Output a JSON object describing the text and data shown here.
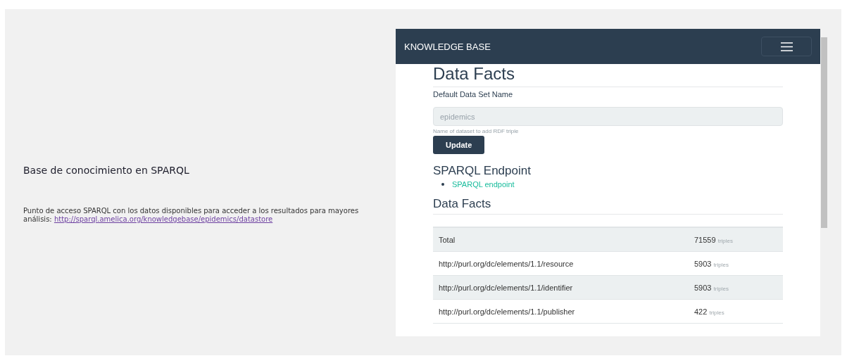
{
  "section": {
    "title": "Base de conocimiento en SPARQL",
    "description": "Punto de acceso SPARQL con los datos disponibles para acceder a los resultados para mayores análisis:",
    "link": "http://sparql.amelica.org/knowledgebase/epidemics/datastore"
  },
  "embedded_page": {
    "navbar": {
      "brand": "KNOWLEDGE BASE"
    },
    "title": "Data Facts",
    "dataset_field": {
      "label": "Default Data Set Name",
      "placeholder": "epidemics",
      "help": "Name of dataset to add RDF triple"
    },
    "update_button": "Update",
    "endpoint_heading": "SPARQL Endpoint",
    "endpoint_links": [
      "SPARQL endpoint"
    ],
    "facts_heading": "Data Facts",
    "facts": [
      {
        "name": "Total",
        "count": "71559",
        "unit": "triples"
      },
      {
        "name": "http://purl.org/dc/elements/1.1/resource",
        "count": "5903",
        "unit": "triples"
      },
      {
        "name": "http://purl.org/dc/elements/1.1/identifier",
        "count": "5903",
        "unit": "triples"
      },
      {
        "name": "http://purl.org/dc/elements/1.1/publisher",
        "count": "422",
        "unit": "triples"
      }
    ]
  }
}
